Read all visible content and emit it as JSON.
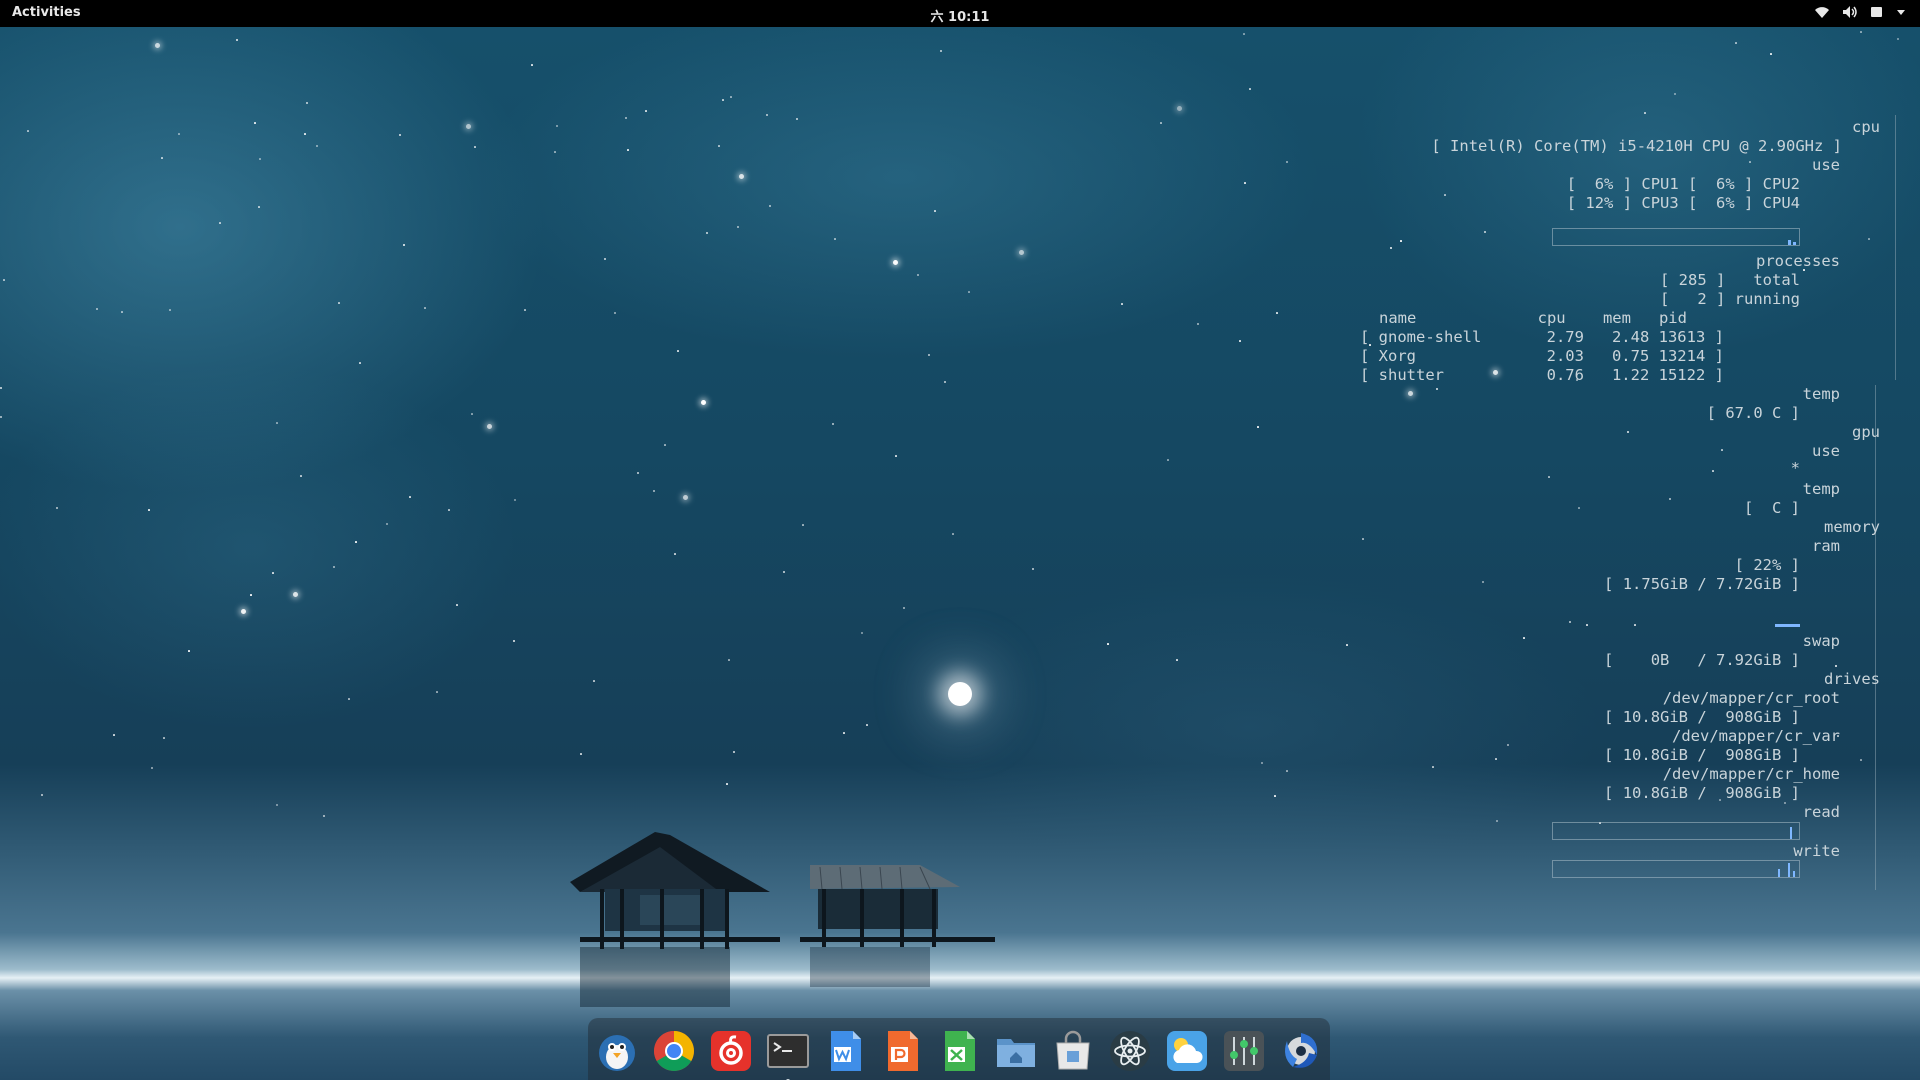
{
  "topbar": {
    "activities": "Activities",
    "clock": "六 10:11",
    "tray_icons": [
      "wifi-icon",
      "volume-icon",
      "battery-icon",
      "dropdown-icon"
    ]
  },
  "conky": {
    "cpu_header": "cpu",
    "cpu_model": "[ Intel(R) Core(TM) i5-4210H CPU @ 2.90GHz ]",
    "use_label": "use",
    "cpu_row1": "[  6% ] CPU1 [  6% ] CPU2",
    "cpu_row2": "[ 12% ] CPU3 [  6% ] CPU4",
    "processes_header": "processes",
    "proc_total": "[ 285 ]   total",
    "proc_running": "[   2 ] running",
    "proc_columns": "name             cpu    mem   pid",
    "proc_rows": [
      "[ gnome-shell       2.79   2.48 13613 ]",
      "[ Xorg              2.03   0.75 13214 ]",
      "[ shutter           0.76   1.22 15122 ]"
    ],
    "temp_label": "temp",
    "cpu_temp": "[ 67.0 C ]",
    "gpu_header": "gpu",
    "gpu_use_label": "use",
    "gpu_use_value": "*",
    "gpu_temp_label": "temp",
    "gpu_temp_value": "[  C ]",
    "memory_header": "memory",
    "ram_label": "ram",
    "ram_percent": "[ 22% ]",
    "ram_usage": "[ 1.75GiB / 7.72GiB ]",
    "swap_label": "swap",
    "swap_usage": "[    0B   / 7.92GiB ]",
    "drives_header": "drives",
    "drives": [
      {
        "name": "/dev/mapper/cr_root",
        "usage": "[ 10.8GiB /  908GiB ]"
      },
      {
        "name": "/dev/mapper/cr_var",
        "usage": "[ 10.8GiB /  908GiB ]"
      },
      {
        "name": "/dev/mapper/cr_home",
        "usage": "[ 10.8GiB /  908GiB ]"
      }
    ],
    "read_label": "read",
    "write_label": "write"
  },
  "dock": {
    "items": [
      {
        "icon": "penguin-icon"
      },
      {
        "icon": "chrome-icon"
      },
      {
        "icon": "netease-music-icon"
      },
      {
        "icon": "terminal-icon",
        "running": true
      },
      {
        "icon": "wps-writer-icon"
      },
      {
        "icon": "wps-presentation-icon"
      },
      {
        "icon": "wps-spreadsheet-icon"
      },
      {
        "icon": "home-folder-icon"
      },
      {
        "icon": "software-store-icon"
      },
      {
        "icon": "atom-icon"
      },
      {
        "icon": "weather-icon"
      },
      {
        "icon": "mixer-icon"
      },
      {
        "icon": "shutter-icon"
      }
    ]
  },
  "colors": {
    "topbar_bg": "#000000",
    "conky_text": "#c9d4da",
    "graph_spike": "#7fb7ff",
    "sky": "#154862"
  }
}
